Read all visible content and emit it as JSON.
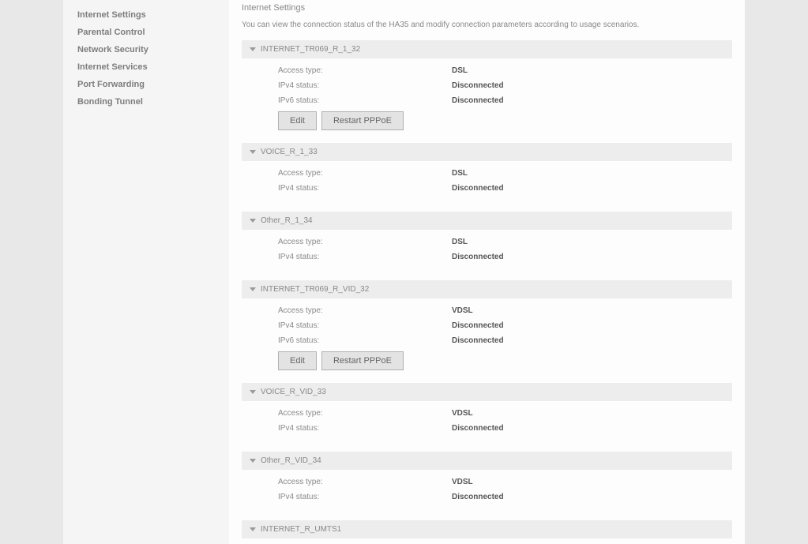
{
  "sidebar": {
    "items": [
      {
        "label": "Internet Settings"
      },
      {
        "label": "Parental Control"
      },
      {
        "label": "Network Security"
      },
      {
        "label": "Internet Services"
      },
      {
        "label": "Port Forwarding"
      },
      {
        "label": "Bonding Tunnel"
      }
    ]
  },
  "page": {
    "title": "Internet Settings",
    "description": "You can view the connection status of the HA35 and modify connection parameters according to usage scenarios."
  },
  "labels": {
    "access_type": "Access type:",
    "ipv4_status": "IPv4 status:",
    "ipv6_status": "IPv6 status:",
    "edit": "Edit",
    "restart_pppoe": "Restart PPPoE"
  },
  "sections": [
    {
      "name": "INTERNET_TR069_R_1_32",
      "access_type": "DSL",
      "ipv4_status": "Disconnected",
      "ipv6_status": "Disconnected",
      "has_ipv6": true,
      "has_buttons": true
    },
    {
      "name": "VOICE_R_1_33",
      "access_type": "DSL",
      "ipv4_status": "Disconnected",
      "has_ipv6": false,
      "has_buttons": false
    },
    {
      "name": "Other_R_1_34",
      "access_type": "DSL",
      "ipv4_status": "Disconnected",
      "has_ipv6": false,
      "has_buttons": false
    },
    {
      "name": "INTERNET_TR069_R_VID_32",
      "access_type": "VDSL",
      "ipv4_status": "Disconnected",
      "ipv6_status": "Disconnected",
      "has_ipv6": true,
      "has_buttons": true
    },
    {
      "name": "VOICE_R_VID_33",
      "access_type": "VDSL",
      "ipv4_status": "Disconnected",
      "has_ipv6": false,
      "has_buttons": false
    },
    {
      "name": "Other_R_VID_34",
      "access_type": "VDSL",
      "ipv4_status": "Disconnected",
      "has_ipv6": false,
      "has_buttons": false
    },
    {
      "name": "INTERNET_R_UMTS1",
      "body_visible": false
    }
  ]
}
